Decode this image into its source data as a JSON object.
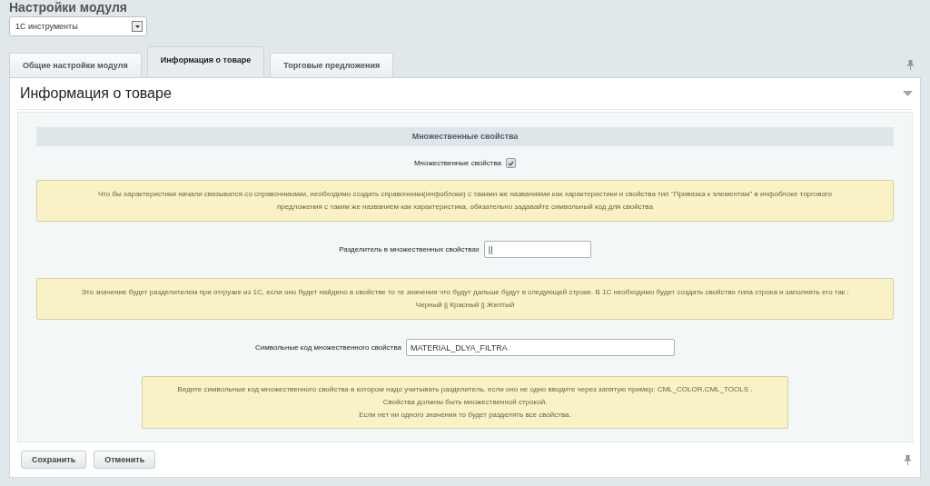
{
  "page_title": "Настройки модуля",
  "module_select": {
    "value": "1С инструменты"
  },
  "tabs": [
    {
      "label": "Общие настройки модуля",
      "selected": false
    },
    {
      "label": "Информация о товаре",
      "selected": true
    },
    {
      "label": "Торговые предложения",
      "selected": false
    }
  ],
  "panel": {
    "title": "Информация о товаре",
    "expanded": true
  },
  "section": {
    "title": "Множественные свойства"
  },
  "rows": [
    {
      "kind": "checkbox",
      "label": "Множественные свойства",
      "checked": true
    },
    {
      "kind": "note",
      "lines": [
        "Что бы характеристики начали связыватся со справочниками, необходимо создать справочники(инфоблоки) с такими же названиями как характеристики и свойства тип \"Привязка к элементам\" в инфоблоке торгового",
        "предложения с таким же названием как характеристика, обязательно задавайте символьный код для свойства"
      ]
    },
    {
      "kind": "field",
      "label": "Разделитель в множественных свойствах",
      "value": "||",
      "wide": false
    },
    {
      "kind": "note",
      "lines": [
        "Это значение будет разделителем при отгрузке из 1С, если оно будет найдено в свойстве то те значения что будут дальше будут в следующей строке. В 1С необходимо будет создать свойство типа строка и заполнять его так :",
        "Черный || Красный || Желтый"
      ]
    },
    {
      "kind": "field",
      "label": "Символьные код множественного свойства",
      "value": "MATERIAL_DLYA_FILTRA",
      "wide": true
    },
    {
      "kind": "note",
      "narrow": true,
      "lines": [
        "Ведите символьные код множественного свойства в котором надо учитывать разделитель, если оно не одно вводите через запятую пример: CML_COLOR,CML_TOOLS .",
        "Свойства должны быть множественной строкой.",
        "Если нет ни одного значения то будет разделять все свойства."
      ]
    }
  ],
  "buttons": [
    {
      "label": "Сохранить"
    },
    {
      "label": "Отменить"
    }
  ]
}
